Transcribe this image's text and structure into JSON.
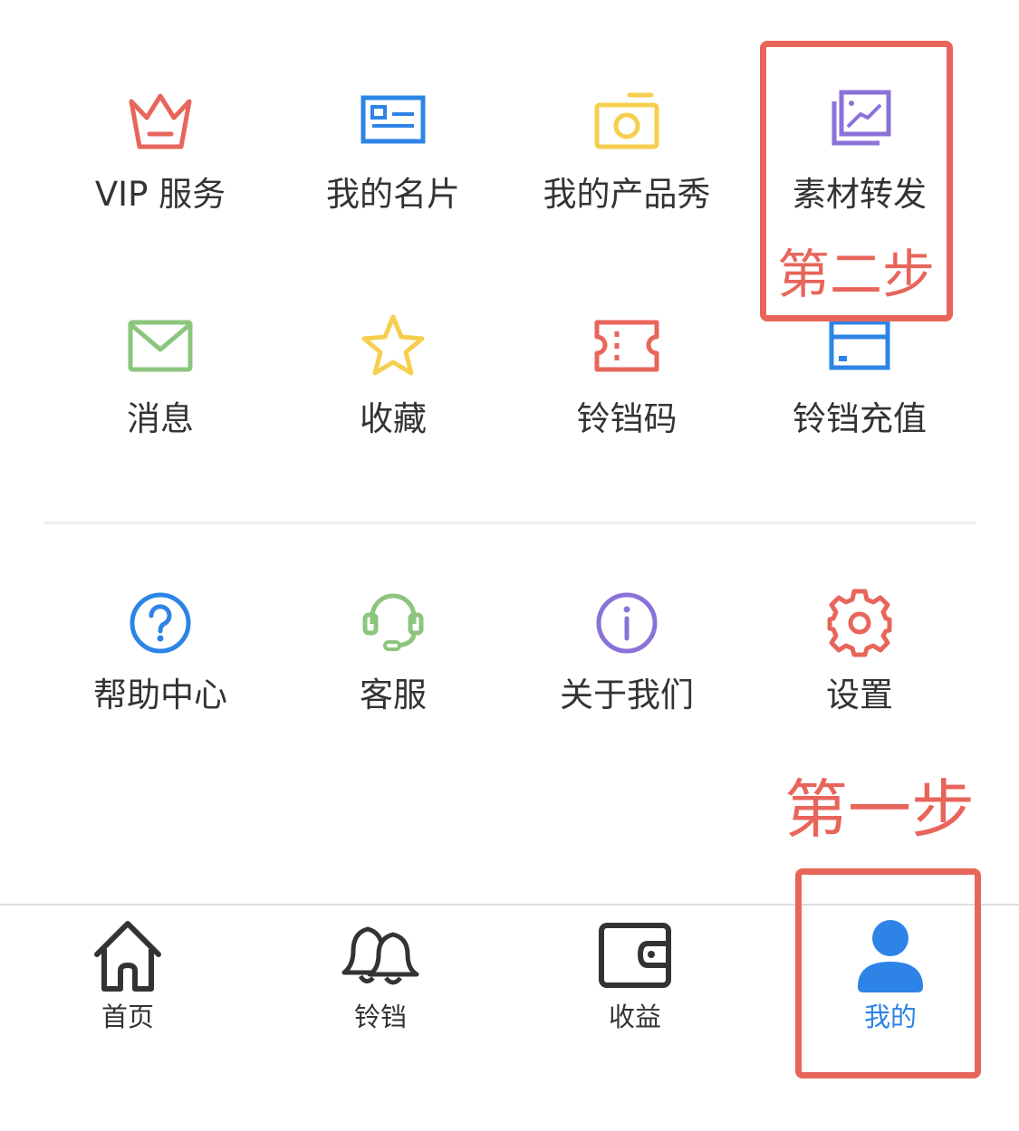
{
  "grid": {
    "row1": [
      {
        "label": "VIP 服务",
        "icon": "crown-icon",
        "color": "#e8655b"
      },
      {
        "label": "我的名片",
        "icon": "business-card-icon",
        "color": "#2d84e6"
      },
      {
        "label": "我的产品秀",
        "icon": "camera-icon",
        "color": "#f5cf4e"
      },
      {
        "label": "素材转发",
        "icon": "gallery-icon",
        "color": "#8a72d9"
      }
    ],
    "row2": [
      {
        "label": "消息",
        "icon": "envelope-icon",
        "color": "#8cc57e"
      },
      {
        "label": "收藏",
        "icon": "star-icon",
        "color": "#f5cf4e"
      },
      {
        "label": "铃铛码",
        "icon": "ticket-icon",
        "color": "#e8655b"
      },
      {
        "label": "铃铛充值",
        "icon": "card-icon",
        "color": "#2d84e6"
      }
    ],
    "row3": [
      {
        "label": "帮助中心",
        "icon": "help-icon",
        "color": "#2d84e6"
      },
      {
        "label": "客服",
        "icon": "headset-icon",
        "color": "#8cc57e"
      },
      {
        "label": "关于我们",
        "icon": "info-icon",
        "color": "#8a72d9"
      },
      {
        "label": "设置",
        "icon": "gear-icon",
        "color": "#e8655b"
      }
    ]
  },
  "tabbar": {
    "items": [
      {
        "label": "首页",
        "icon": "home-icon"
      },
      {
        "label": "铃铛",
        "icon": "bell-icon"
      },
      {
        "label": "收益",
        "icon": "wallet-icon"
      },
      {
        "label": "我的",
        "icon": "user-icon",
        "active": true
      }
    ],
    "active_color": "#2d84e6",
    "inactive_color": "#333333"
  },
  "annotations": {
    "step1": "第一步",
    "step2": "第二步",
    "color": "#e8655b"
  }
}
